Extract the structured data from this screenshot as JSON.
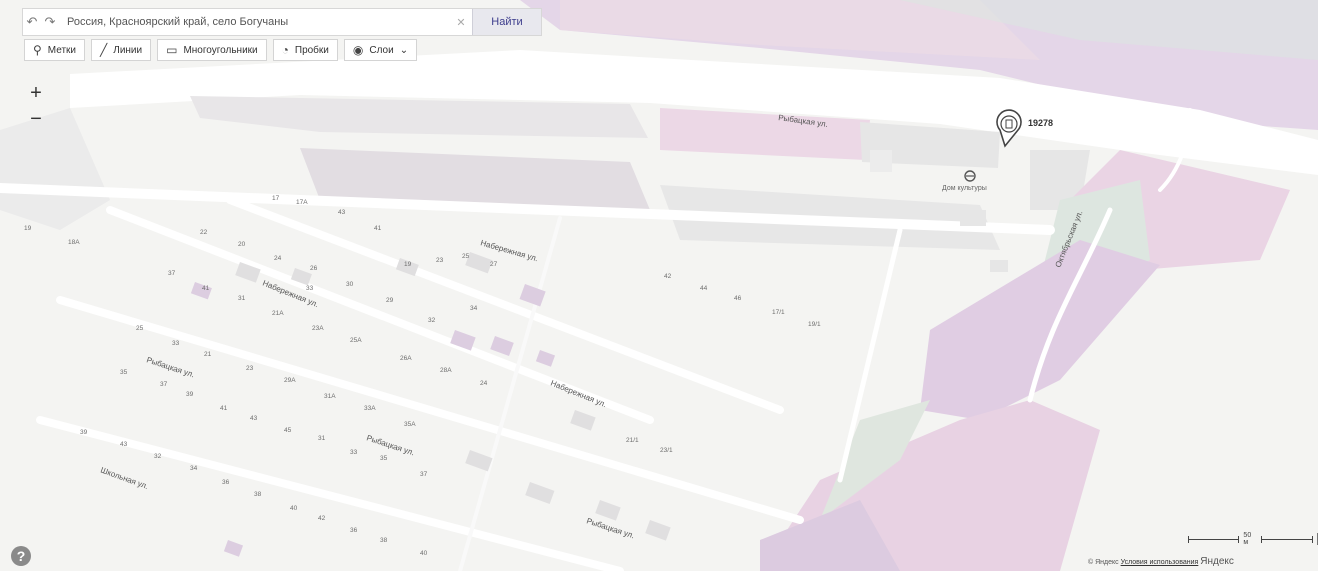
{
  "search": {
    "query": "Россия, Красноярский край, село Богучаны",
    "find_label": "Найти"
  },
  "toolbar": {
    "items": [
      {
        "label": "Метки",
        "icon": "pin-icon"
      },
      {
        "label": "Линии",
        "icon": "line-icon"
      },
      {
        "label": "Многоугольники",
        "icon": "polygon-icon"
      },
      {
        "label": "Пробки",
        "icon": "traffic-icon"
      },
      {
        "label": "Слои",
        "icon": "layers-icon"
      }
    ]
  },
  "zoom": {
    "in": "+",
    "out": "−"
  },
  "help": "?",
  "map": {
    "streets": [
      "Набережная ул.",
      "Набережная ул.",
      "Набережная ул.",
      "Рыбацкая ул.",
      "Рыбацкая ул.",
      "Рыбацкая ул.",
      "Школьная ул.",
      "Рыбацкая ул.",
      "Октябрьская ул."
    ],
    "places": [
      {
        "label": "Дом культуры"
      }
    ],
    "marker": {
      "label": "19278"
    },
    "house_numbers": [
      "17",
      "17А",
      "43",
      "41",
      "19",
      "18А",
      "22",
      "20",
      "24",
      "26",
      "19",
      "23",
      "25",
      "27",
      "37",
      "41",
      "31",
      "33",
      "30",
      "29",
      "32",
      "34",
      "21А",
      "23А",
      "25А",
      "26А",
      "28А",
      "24",
      "25",
      "33",
      "21",
      "23",
      "29А",
      "31А",
      "33А",
      "35А",
      "35",
      "37",
      "39",
      "41",
      "43",
      "45",
      "31",
      "33",
      "35",
      "37",
      "39",
      "43",
      "32",
      "34",
      "36",
      "38",
      "40",
      "42",
      "36",
      "38",
      "40",
      "42",
      "44",
      "46",
      "17/1",
      "19/1",
      "21/1",
      "23/1"
    ]
  },
  "scale": {
    "label": "50 м"
  },
  "copyright": {
    "text": "© Яндекс",
    "link": "Условия использования",
    "logo": "Яндекс"
  }
}
